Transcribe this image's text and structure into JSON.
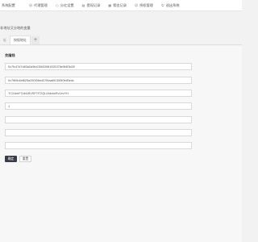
{
  "brand": "系统配置",
  "nav": [
    {
      "icon": "user-icon",
      "glyph": "☺",
      "label": "代理管理"
    },
    {
      "icon": "circle-icon",
      "glyph": "○",
      "label": "分红设置"
    },
    {
      "icon": "document-icon",
      "glyph": "▤",
      "label": "提现记录"
    },
    {
      "icon": "grid-icon",
      "glyph": "▦",
      "label": "佣金记录"
    },
    {
      "icon": "user-icon",
      "glyph": "☺",
      "label": "授权管理"
    },
    {
      "icon": "power-icon",
      "glyph": "⏻",
      "label": "退出系统"
    }
  ],
  "hint": "非地址又分地的变量",
  "tabs": [
    {
      "label": "址",
      "active": false
    },
    {
      "label": "授权地址",
      "active": true
    }
  ],
  "tab_add_label": "+",
  "section_title": "克隆钱",
  "fields": [
    {
      "value": "0x7fc47d7d83a0d9fc03f46398192f1f78e5f4f3d39",
      "placeholder": ""
    },
    {
      "value": "0x7f89b4bf825a250f3bb407f6aa6f1353f0fdf3edc",
      "placeholder": ""
    },
    {
      "value": "TCXAmFCdb1BVSP7f72QL0Ab4wRv1evYH",
      "placeholder": ""
    },
    {
      "value": "1",
      "placeholder": ""
    },
    {
      "value": "",
      "placeholder": ""
    },
    {
      "value": "",
      "placeholder": ""
    },
    {
      "value": "",
      "placeholder": ""
    }
  ],
  "buttons": {
    "confirm": "确定",
    "reset": "重置"
  },
  "colors": {
    "primary_button": "#393d49",
    "background": "#f2f2f2"
  }
}
